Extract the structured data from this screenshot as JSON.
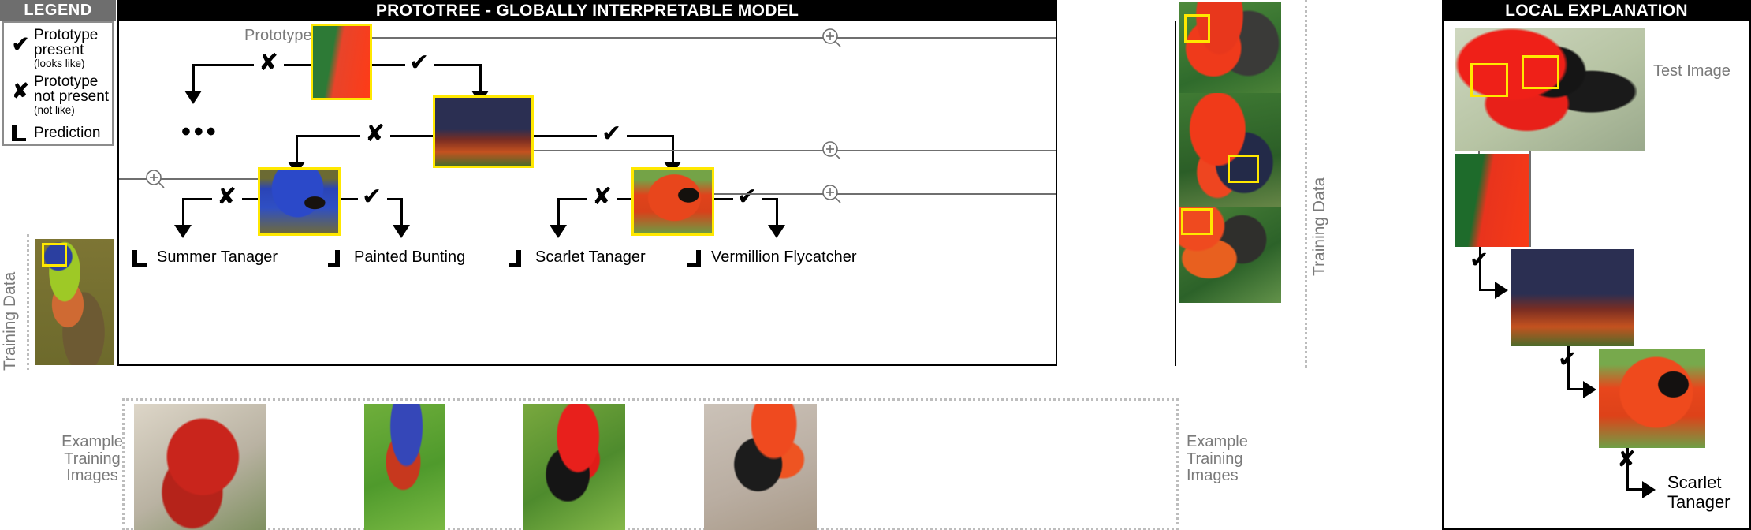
{
  "legend": {
    "title": "LEGEND",
    "items": [
      {
        "glyph": "check-mark",
        "symbol": "✔",
        "main": "Prototype present",
        "sub": "(looks like)"
      },
      {
        "glyph": "cross-mark",
        "symbol": "✘",
        "main": "Prototype not present",
        "sub": "(not like)"
      },
      {
        "glyph": "prediction-bars",
        "symbol": "",
        "main": "Prediction",
        "sub": ""
      }
    ]
  },
  "global": {
    "title": "PROTOTREE - GLOBALLY INTERPRETABLE MODEL",
    "prototype_label": "Prototype",
    "ellipsis": "•••",
    "edge_absent": "✘",
    "edge_present": "✔",
    "leaves": [
      {
        "label": "Summer Tanager"
      },
      {
        "label": "Painted Bunting"
      },
      {
        "label": "Scarlet Tanager"
      },
      {
        "label": "Vermillion Flycatcher"
      }
    ],
    "training_data_left": "Training Data",
    "training_data_right": "Training Data",
    "example_label_left": "Example Training Images",
    "example_label_right": "Example Training Images",
    "zoom_icon": "magnifier-plus-icon"
  },
  "local": {
    "title": "LOCAL EXPLANATION",
    "test_image_label": "Test Image",
    "steps": [
      {
        "mark": "✔"
      },
      {
        "mark": "✔"
      },
      {
        "mark": "✘"
      }
    ],
    "prediction": "Scarlet Tanager"
  },
  "colors": {
    "prototype_border": "#ffe800",
    "header_bg": "#000000",
    "legend_header_bg": "#6e6e6e",
    "gray_text": "#7a7a7a",
    "connector_gray": "#6f6f6f",
    "dashed_gray": "#bdbdbd"
  }
}
